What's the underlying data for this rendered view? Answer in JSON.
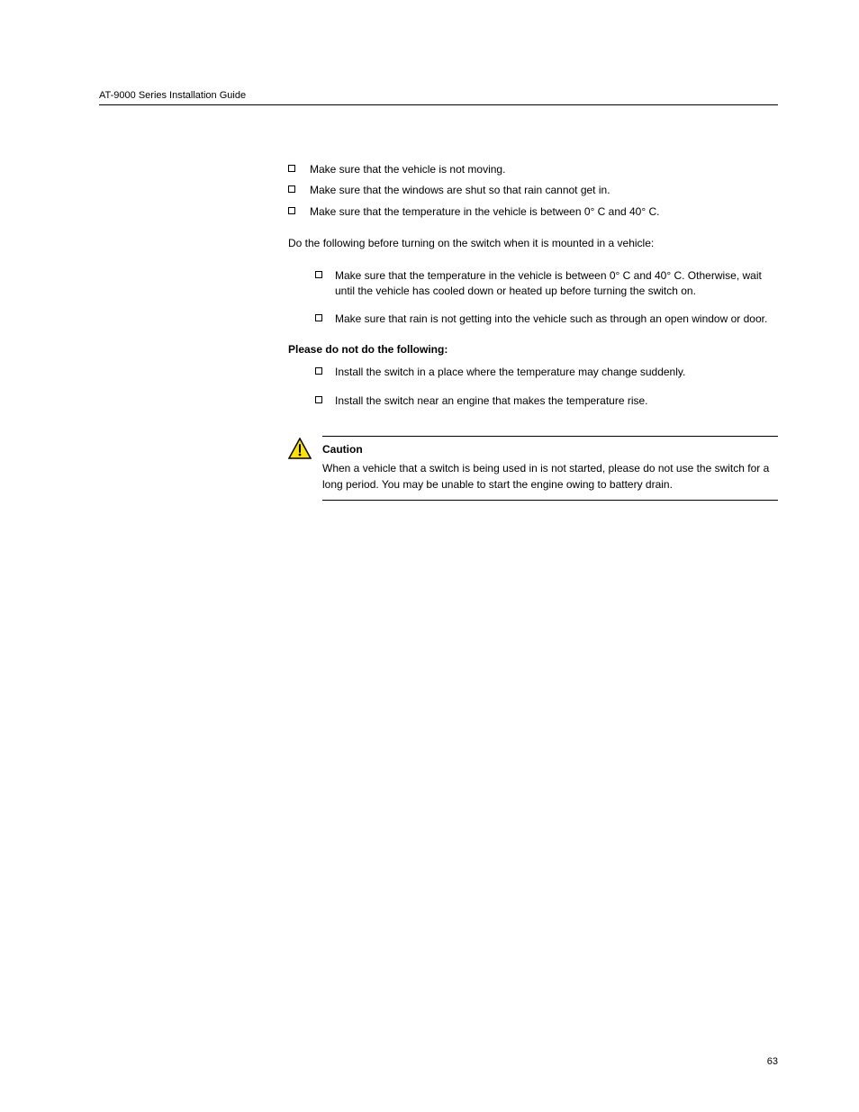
{
  "header": {
    "title": "AT-9000 Series Installation Guide"
  },
  "content": {
    "top_list": [
      "Make sure that the vehicle is not moving.",
      "Make sure that the windows are shut so that rain cannot get in.",
      "Make sure that the temperature in the vehicle is between 0° C and 40° C."
    ],
    "intro_para": "Do the following before turning on the switch when it is mounted in a vehicle:",
    "second_list": [
      "Make sure that the temperature in the vehicle is between 0° C and 40° C. Otherwise, wait until the vehicle has cooled down or heated up before turning the switch on.",
      "Make sure that rain is not getting into the vehicle such as through an open window or door."
    ],
    "dont_heading": "Please do not do the following:",
    "third_list": [
      "Install the switch in a place where the temperature may change suddenly.",
      "Install the switch near an engine that makes the temperature rise."
    ],
    "caution": {
      "title": "Caution",
      "text": "When a vehicle that a switch is being used in is not started, please do not use the switch for a long period. You may be unable to start the engine owing to battery drain."
    }
  },
  "page_number": "63"
}
